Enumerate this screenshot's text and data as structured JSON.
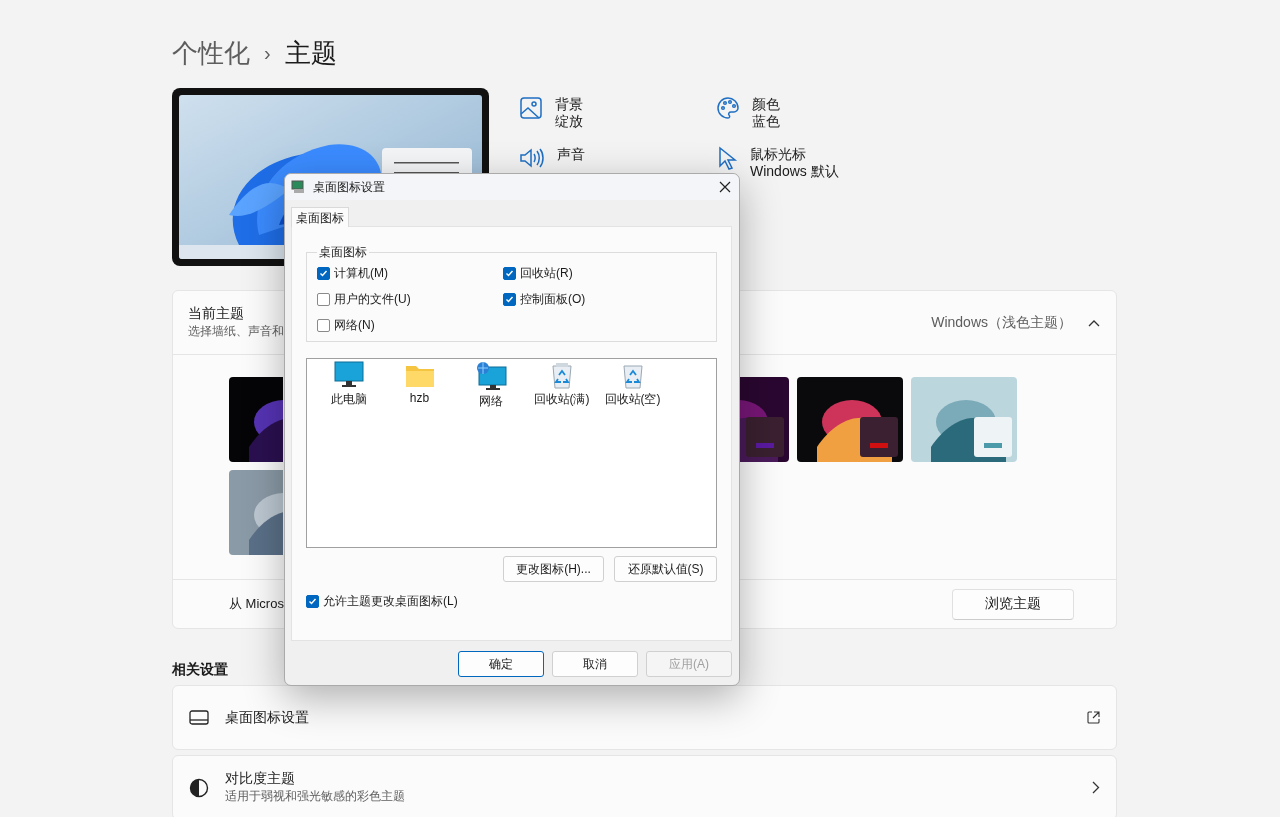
{
  "breadcrumb": {
    "parent": "个性化",
    "separator": "›",
    "current": "主题"
  },
  "quick_settings": [
    {
      "kind": "background",
      "label": "背景",
      "value": "绽放"
    },
    {
      "kind": "color",
      "label": "颜色",
      "value": "蓝色"
    },
    {
      "kind": "sound",
      "label": "声音"
    },
    {
      "kind": "cursor",
      "label": "鼠标光标",
      "value": "Windows 默认"
    }
  ],
  "current_theme": {
    "title": "当前主题",
    "subtitle": "选择墙纸、声音和",
    "value": "Windows（浅色主题）",
    "expanded": true,
    "store_text": "从 Micros",
    "browse_button": "浏览主题"
  },
  "related": {
    "title": "相关设置",
    "items": [
      {
        "kind": "external",
        "title": "桌面图标设置"
      },
      {
        "kind": "navigate",
        "title": "对比度主题",
        "subtitle": "适用于弱视和强光敏感的彩色主题"
      }
    ]
  },
  "dialog": {
    "title": "桌面图标设置",
    "tabs": [
      {
        "label": "桌面图标",
        "selected": true
      }
    ],
    "group_title": "桌面图标",
    "checkboxes": [
      {
        "label": "计算机(M)",
        "checked": true
      },
      {
        "label": "回收站(R)",
        "checked": true
      },
      {
        "label": "用户的文件(U)",
        "checked": false
      },
      {
        "label": "控制面板(O)",
        "checked": true
      },
      {
        "label": "网络(N)",
        "checked": false
      }
    ],
    "icons": [
      {
        "kind": "computer",
        "label": "此电脑"
      },
      {
        "kind": "folder",
        "label": "hzb"
      },
      {
        "kind": "network",
        "label": "网络"
      },
      {
        "kind": "recycle_full",
        "label": "回收站(满)"
      },
      {
        "kind": "recycle_empty",
        "label": "回收站(空)"
      }
    ],
    "change_icon_button": "更改图标(H)...",
    "restore_button": "还原默认值(S)",
    "allow_themes": {
      "label": "允许主题更改桌面图标(L)",
      "checked": true
    },
    "buttons": [
      {
        "label": "确定",
        "default": true,
        "disabled": false
      },
      {
        "label": "取消",
        "default": false,
        "disabled": false
      },
      {
        "label": "应用(A)",
        "default": false,
        "disabled": true
      }
    ]
  }
}
